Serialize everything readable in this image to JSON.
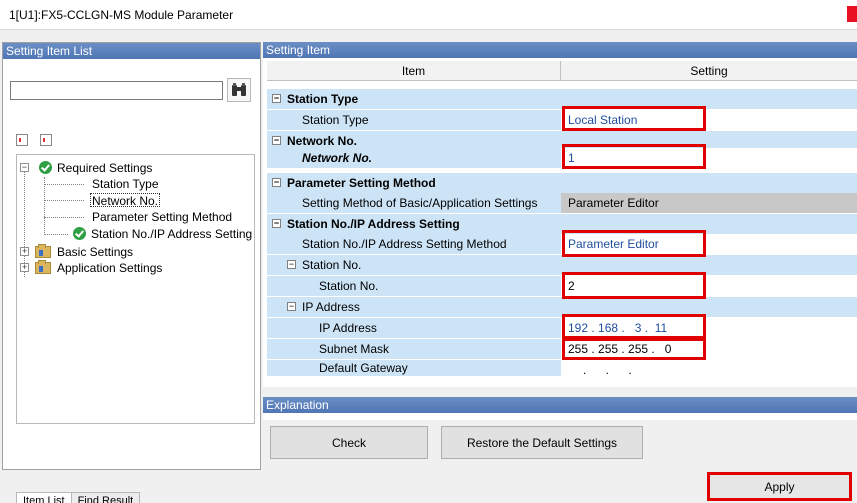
{
  "window": {
    "title": "1[U1]:FX5-CCLGN-MS Module Parameter"
  },
  "left_panel": {
    "header": "Setting Item List",
    "search": {
      "value": "",
      "placeholder": ""
    },
    "tree": {
      "required": "Required Settings",
      "station_type": "Station Type",
      "network_no": "Network No.",
      "param_method": "Parameter Setting Method",
      "station_ip": "Station No./IP Address Setting",
      "basic": "Basic Settings",
      "application": "Application Settings"
    },
    "tabs": {
      "item_list": "Item List",
      "find_result": "Find Result"
    }
  },
  "right_panel": {
    "header": "Setting Item",
    "columns": {
      "item": "Item",
      "setting": "Setting"
    },
    "rows": {
      "station_type_group": "Station Type",
      "station_type": "Station Type",
      "station_type_val": "Local Station",
      "network_group": "Network No.",
      "network_no": "Network No.",
      "network_no_val": "1",
      "param_group": "Parameter Setting Method",
      "param_method": "Setting Method of Basic/Application Settings",
      "param_method_val": "Parameter Editor",
      "stip_group": "Station No./IP Address Setting",
      "stip_method": "Station No./IP Address Setting Method",
      "stip_method_val": "Parameter Editor",
      "station_no_group": "Station No.",
      "station_no": "Station No.",
      "station_no_val": "2",
      "ip_group": "IP Address",
      "ip_address": "IP Address",
      "ip_address_val": "192 . 168 .   3 .  11",
      "subnet": "Subnet Mask",
      "subnet_val": "255 . 255 . 255 .   0",
      "gateway": "Default Gateway",
      "gateway_val": ". . ."
    }
  },
  "explanation": {
    "header": "Explanation"
  },
  "buttons": {
    "check": "Check",
    "restore": "Restore the Default Settings",
    "apply": "Apply"
  },
  "colors": {
    "highlight": "#e00000",
    "header_blue": "#5279b8",
    "cell_blue": "#cde4f7",
    "value_blue": "#1f4e9e"
  }
}
